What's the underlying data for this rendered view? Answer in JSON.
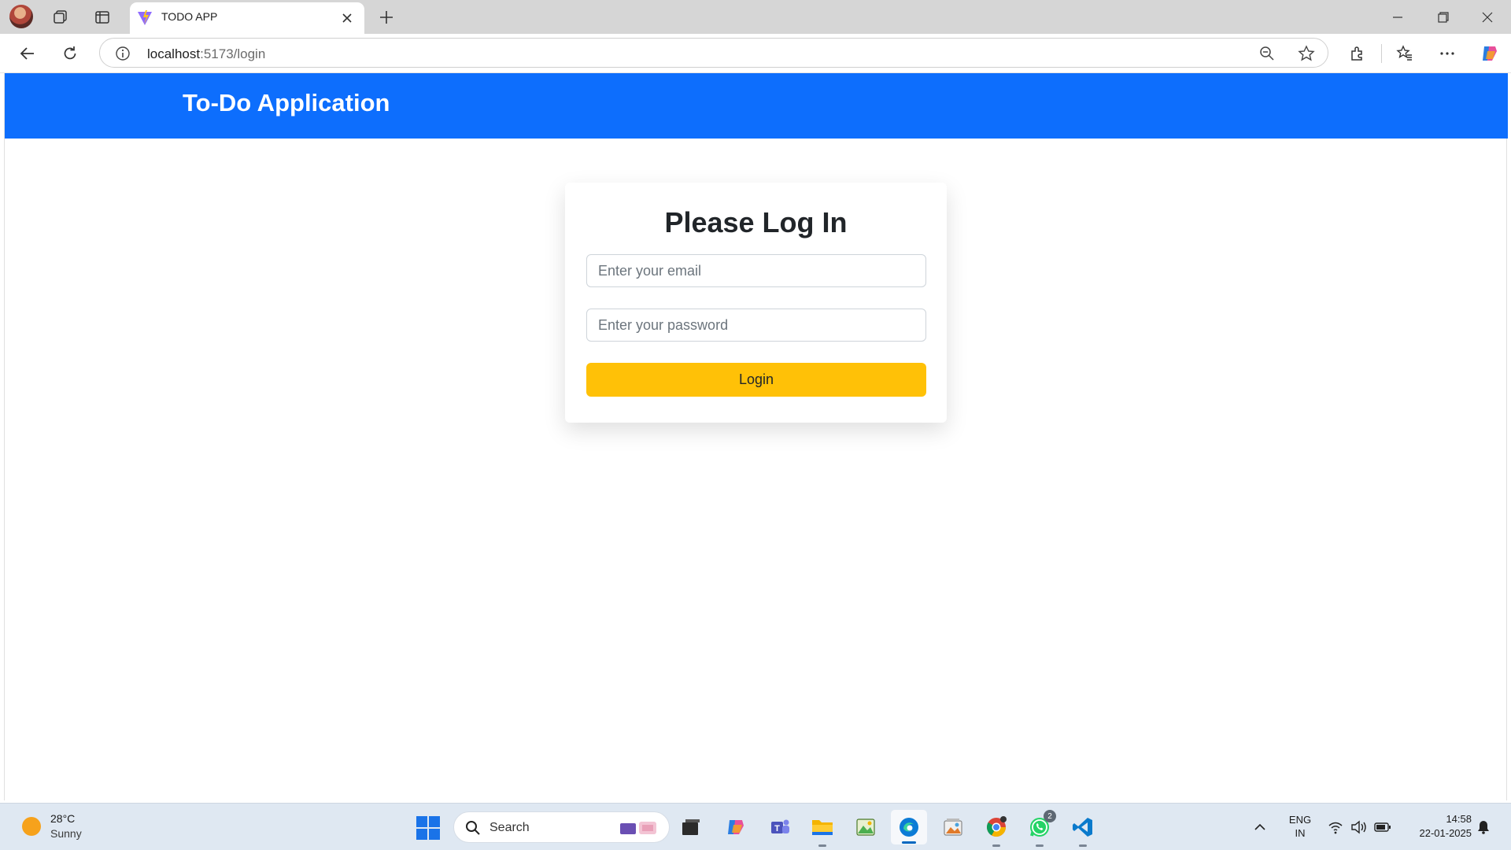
{
  "browser": {
    "tab_title": "TODO APP",
    "url_host": "localhost",
    "url_path": ":5173/login"
  },
  "app": {
    "brand": "To-Do Application",
    "brand_color": "#0d6efd"
  },
  "login": {
    "title": "Please Log In",
    "email_placeholder": "Enter your email",
    "email_value": "",
    "password_placeholder": "Enter your password",
    "password_value": "",
    "button_label": "Login",
    "button_color": "#ffc107"
  },
  "taskbar": {
    "weather_temp": "28°C",
    "weather_condition": "Sunny",
    "search_label": "Search",
    "whatsapp_badge": "2",
    "language_line1": "ENG",
    "language_line2": "IN",
    "time": "14:58",
    "date": "22-01-2025",
    "apps": [
      "file-explorer-icon",
      "copilot-icon",
      "teams-icon",
      "folder-icon",
      "photos-icon",
      "edge-icon",
      "gallery-icon",
      "chrome-icon",
      "whatsapp-icon",
      "vscode-icon"
    ]
  }
}
